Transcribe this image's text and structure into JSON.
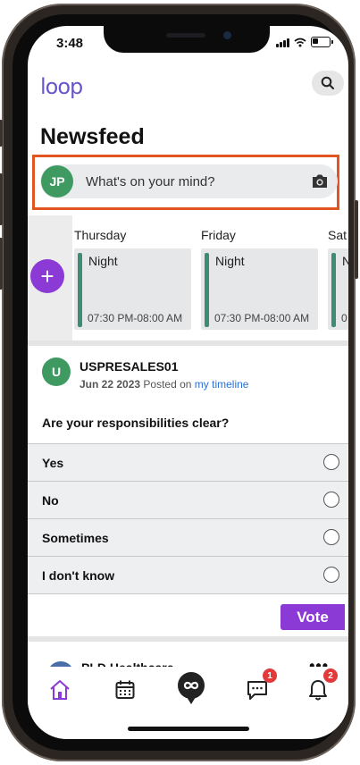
{
  "status_bar": {
    "time": "3:48"
  },
  "header": {
    "logo": "loop",
    "search_icon": "search-icon"
  },
  "page": {
    "title": "Newsfeed"
  },
  "composer": {
    "avatar_initials": "JP",
    "placeholder": "What's on your mind?",
    "camera_icon": "camera-icon"
  },
  "schedule": {
    "add_icon": "plus-icon",
    "days": [
      {
        "day": "Thursday",
        "shift": "Night",
        "time": "07:30 PM-08:00 AM"
      },
      {
        "day": "Friday",
        "shift": "Night",
        "time": "07:30 PM-08:00 AM"
      },
      {
        "day": "Sat",
        "shift": "N",
        "time": "0"
      }
    ]
  },
  "post": {
    "avatar_initial": "U",
    "user": "USPRESALES01",
    "date": "Jun 22 2023",
    "posted_on": "Posted on",
    "timeline_link": "my timeline",
    "question": "Are your responsibilities clear?",
    "options": [
      "Yes",
      "No",
      "Sometimes",
      "I don't know"
    ],
    "vote_label": "Vote"
  },
  "next_post": {
    "name": "PLD Healthcare",
    "more": "•••"
  },
  "tabbar": {
    "tabs": [
      "home",
      "calendar",
      "loop",
      "chat",
      "notifications"
    ],
    "chat_badge": "1",
    "notifications_badge": "2"
  },
  "colors": {
    "brand": "#8b3ad6",
    "avatar_green": "#3f9a62",
    "highlight": "#e15620",
    "shift_bar": "#3d8c73",
    "badge": "#e23a3a"
  }
}
